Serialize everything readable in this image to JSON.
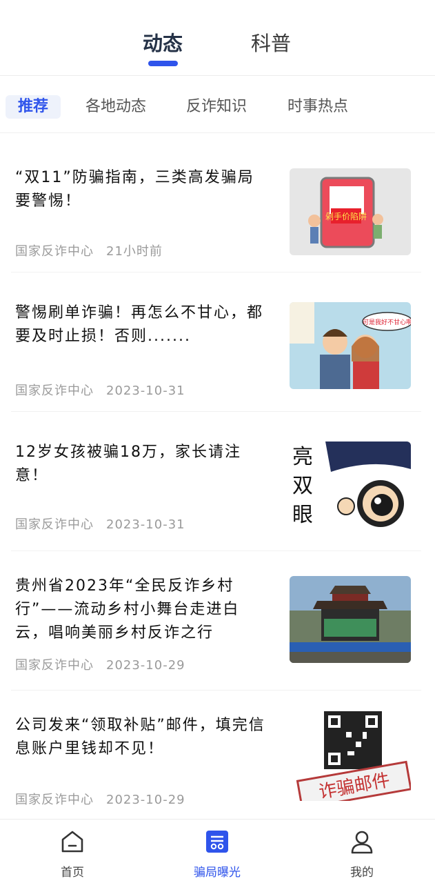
{
  "top_tabs": [
    {
      "label": "动态",
      "active": true
    },
    {
      "label": "科普",
      "active": false
    }
  ],
  "categories": [
    {
      "label": "推荐",
      "active": true
    },
    {
      "label": "各地动态",
      "active": false
    },
    {
      "label": "反诈知识",
      "active": false
    },
    {
      "label": "时事热点",
      "active": false
    }
  ],
  "articles": [
    {
      "title": "“双11”防骗指南，三类高发骗局要警惕！",
      "source": "国家反诈中心",
      "time": "21小时前",
      "thumb_text": "剁手价陷阱"
    },
    {
      "title": "警惕刷单诈骗！再怎么不甘心，都要及时止损！否则.......",
      "source": "国家反诈中心",
      "time": "2023-10-31",
      "thumb_text": "可是我好不甘心啊"
    },
    {
      "title": "12岁女孩被骗18万，家长请注意！",
      "source": "国家反诈中心",
      "time": "2023-10-31",
      "thumb_text": "擦亮双眼"
    },
    {
      "title": "贵州省2023年“全民反诈乡村行”——流动乡村小舞台走进白云，唱响美丽乡村反诈之行",
      "source": "国家反诈中心",
      "time": "2023-10-29",
      "thumb_text": ""
    },
    {
      "title": "公司发来“领取补贴”邮件，填完信息账户里钱却不见！",
      "source": "国家反诈中心",
      "time": "2023-10-29",
      "thumb_text": "诈骗邮件"
    }
  ],
  "bottom_nav": [
    {
      "label": "首页",
      "icon": "home-icon",
      "active": false
    },
    {
      "label": "骗局曝光",
      "icon": "exposure-icon",
      "active": true
    },
    {
      "label": "我的",
      "icon": "user-icon",
      "active": false
    }
  ],
  "colors": {
    "accent": "#2f54eb"
  }
}
